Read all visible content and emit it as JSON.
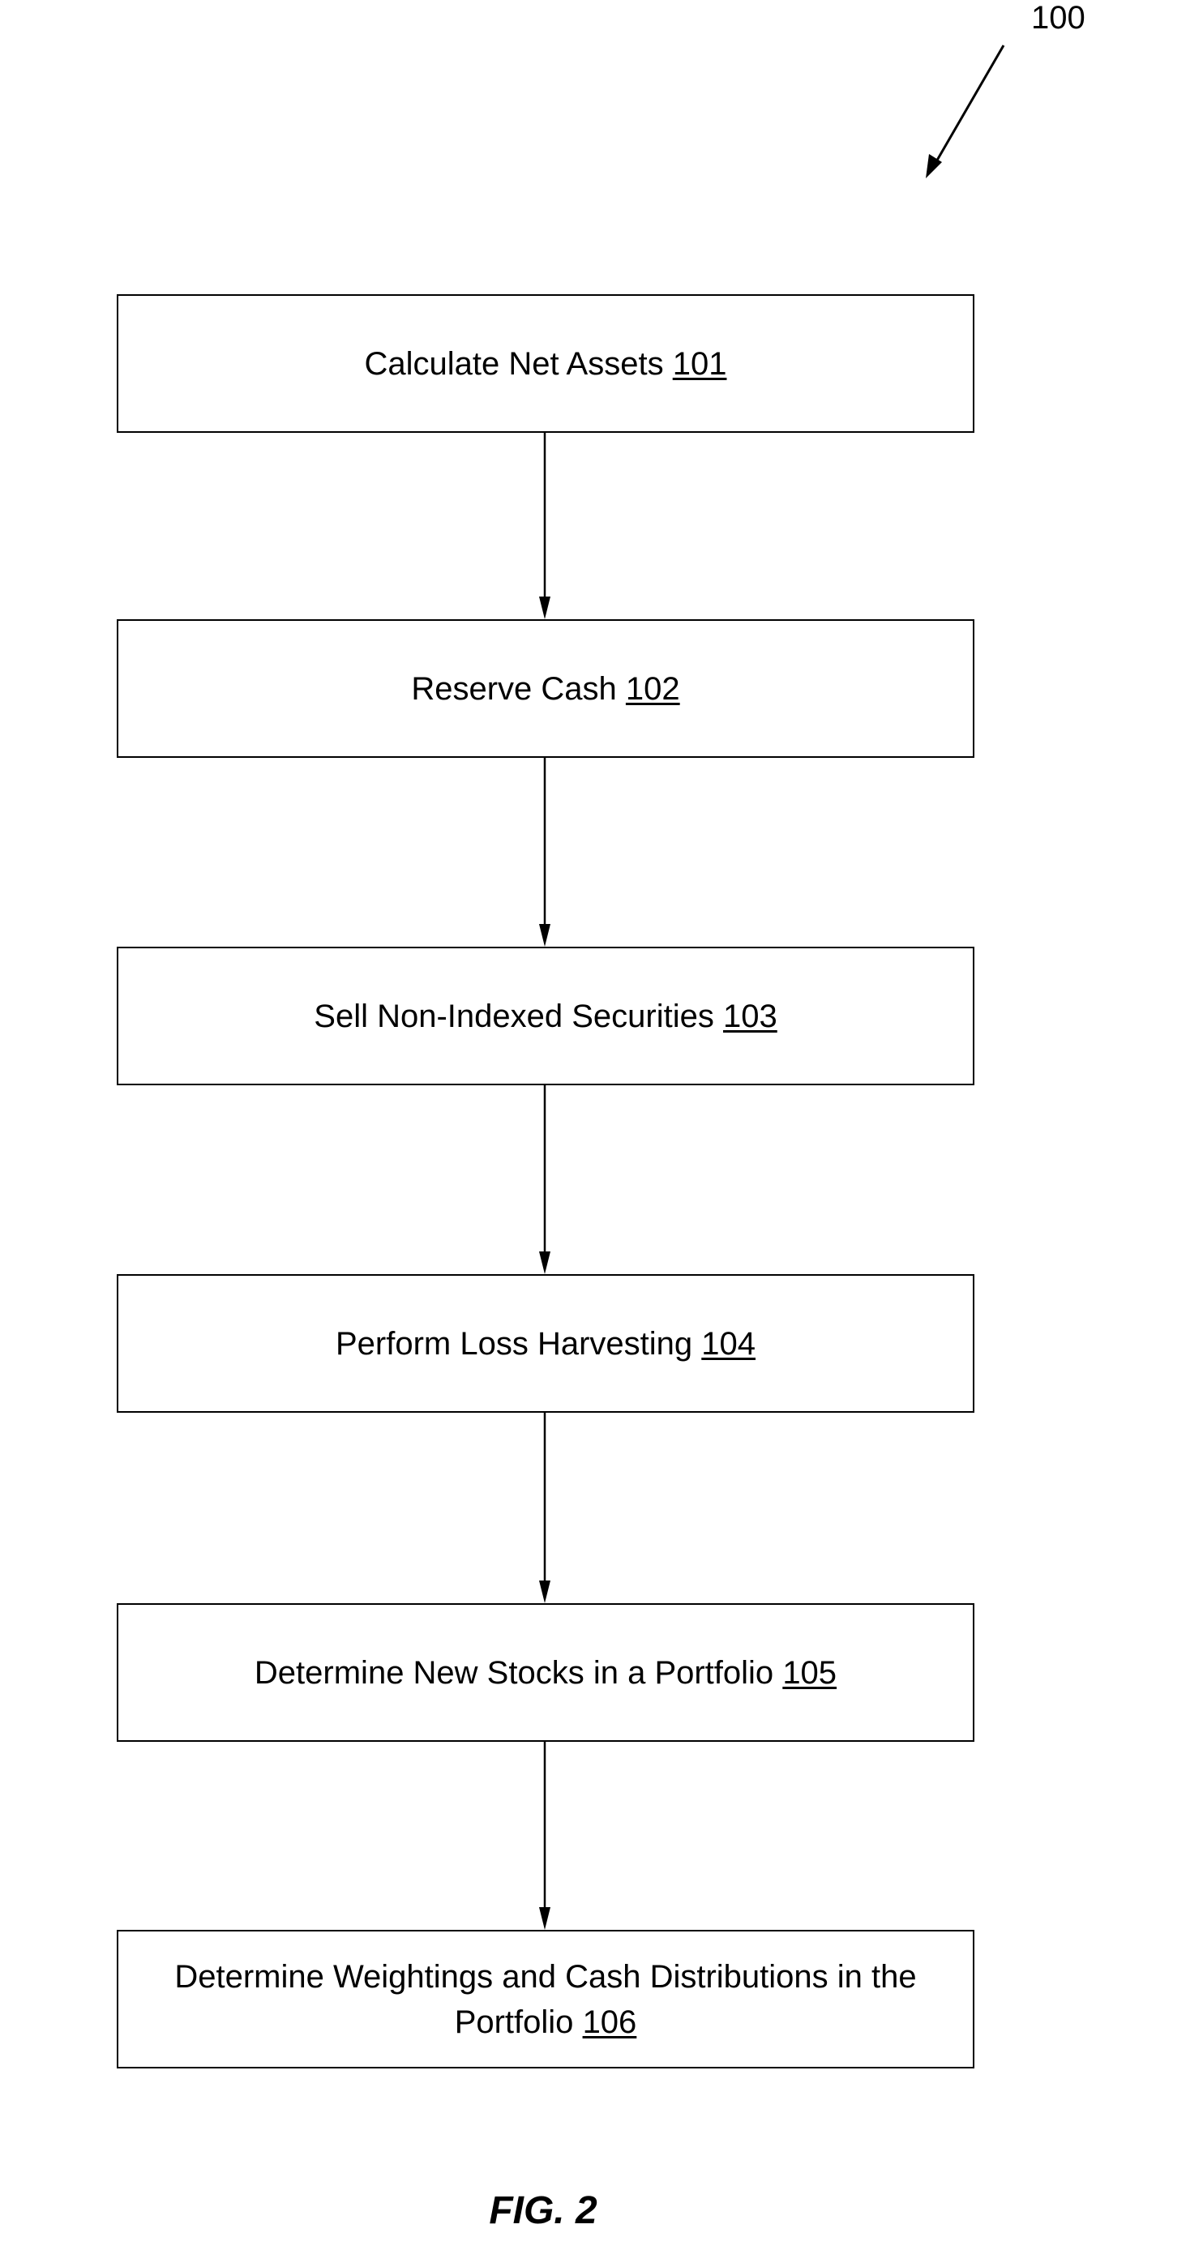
{
  "figure": {
    "reference_numeral": "100",
    "caption": "FIG. 2"
  },
  "steps": [
    {
      "text": "Calculate Net Assets",
      "ref": "101"
    },
    {
      "text": "Reserve Cash",
      "ref": "102"
    },
    {
      "text": "Sell Non-Indexed Securities",
      "ref": "103"
    },
    {
      "text": "Perform Loss Harvesting",
      "ref": "104"
    },
    {
      "text": "Determine New Stocks in a Portfolio",
      "ref": "105"
    },
    {
      "text": "Determine Weightings and Cash Distributions in the Portfolio",
      "ref": "106"
    }
  ],
  "colors": {
    "line": "#000000",
    "background": "#ffffff"
  }
}
